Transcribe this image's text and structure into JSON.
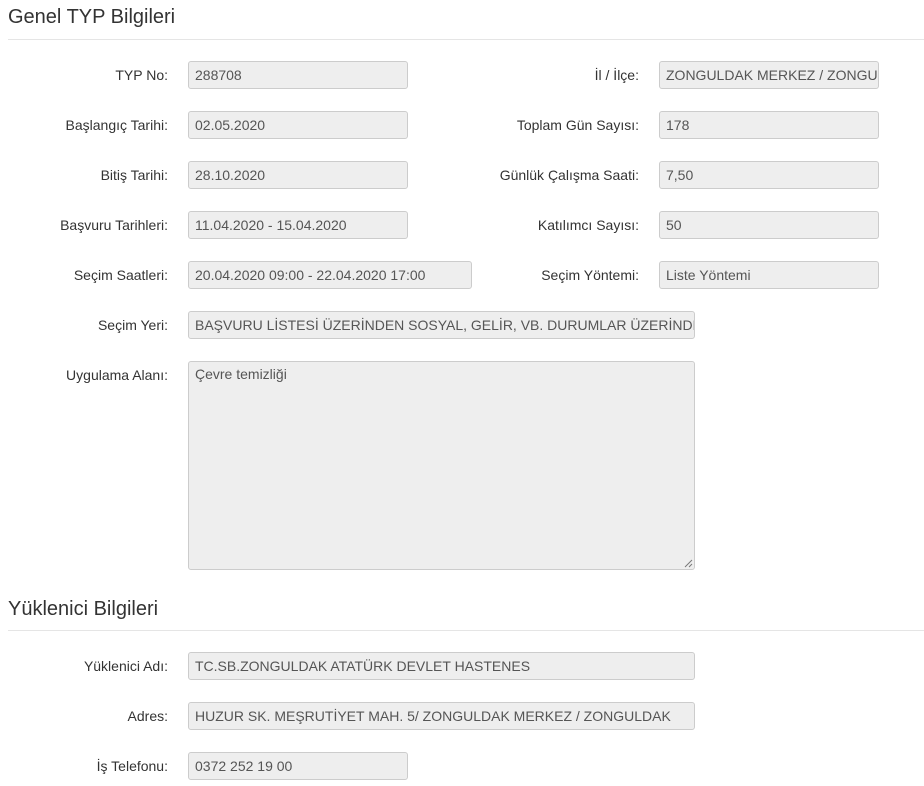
{
  "general": {
    "title": "Genel TYP Bilgileri",
    "typ_no": {
      "label": "TYP No:",
      "value": "288708"
    },
    "il_ilce": {
      "label": "İl / İlçe:",
      "value": "ZONGULDAK MERKEZ / ZONGULDAK"
    },
    "baslangic": {
      "label": "Başlangıç Tarihi:",
      "value": "02.05.2020"
    },
    "toplam_gun": {
      "label": "Toplam Gün Sayısı:",
      "value": "178"
    },
    "bitis": {
      "label": "Bitiş Tarihi:",
      "value": "28.10.2020"
    },
    "gunluk_saat": {
      "label": "Günlük Çalışma Saati:",
      "value": "7,50"
    },
    "basvuru_tarihleri": {
      "label": "Başvuru Tarihleri:",
      "value": "11.04.2020 - 15.04.2020"
    },
    "katilimci": {
      "label": "Katılımcı Sayısı:",
      "value": "50"
    },
    "secim_saatleri": {
      "label": "Seçim Saatleri:",
      "value": "20.04.2020 09:00 - 22.04.2020 17:00"
    },
    "secim_yontemi": {
      "label": "Seçim Yöntemi:",
      "value": "Liste Yöntemi"
    },
    "secim_yeri": {
      "label": "Seçim Yeri:",
      "value": "BAŞVURU LİSTESİ ÜZERİNDEN SOSYAL, GELİR, VB. DURUMLAR ÜZERİNDEN"
    },
    "uygulama_alani": {
      "label": "Uygulama Alanı:",
      "value": "Çevre temizliği"
    }
  },
  "contractor": {
    "title": "Yüklenici Bilgileri",
    "ad": {
      "label": "Yüklenici Adı:",
      "value": "TC.SB.ZONGULDAK ATATÜRK DEVLET HASTENES"
    },
    "adres": {
      "label": "Adres:",
      "value": "HUZUR SK. MEŞRUTİYET MAH. 5/ ZONGULDAK MERKEZ / ZONGULDAK"
    },
    "telefon": {
      "label": "İş Telefonu:",
      "value": "0372 252 19 00"
    }
  },
  "icons": {
    "textarea_resize": "resize-handle-icon"
  }
}
